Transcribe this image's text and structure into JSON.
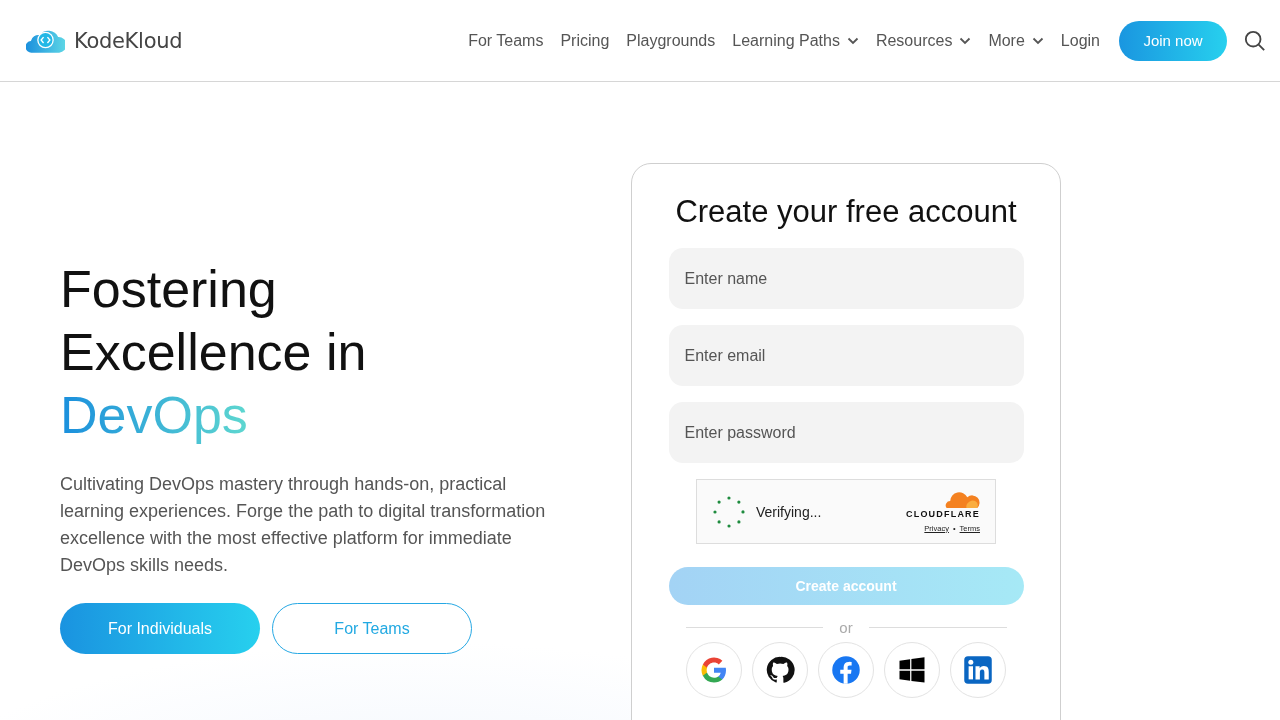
{
  "header": {
    "logo_text": "KodeKloud",
    "nav": [
      {
        "label": "For Teams",
        "kind": "link"
      },
      {
        "label": "Pricing",
        "kind": "link"
      },
      {
        "label": "Playgrounds",
        "kind": "link"
      },
      {
        "label": "Learning Paths",
        "kind": "dropdown"
      },
      {
        "label": "Resources",
        "kind": "dropdown"
      },
      {
        "label": "More",
        "kind": "dropdown"
      },
      {
        "label": "Login",
        "kind": "link"
      }
    ],
    "join_button": "Join now"
  },
  "hero": {
    "heading": "Fostering Excellence in",
    "heading_accent": "DevOps",
    "description": "Cultivating DevOps mastery through hands-on, practical learning experiences. Forge the path to digital transformation excellence with the most effective platform for immediate DevOps skills needs.",
    "buttons": [
      {
        "label": "For Individuals",
        "kind": "primary"
      },
      {
        "label": "For Teams",
        "kind": "outline"
      }
    ]
  },
  "signup": {
    "title": "Create your free account",
    "fields": [
      {
        "placeholder": "Enter name"
      },
      {
        "placeholder": "Enter email"
      },
      {
        "placeholder": "Enter password"
      }
    ],
    "captcha": {
      "status": "Verifying...",
      "brand": "CLOUDFLARE",
      "links": [
        "Privacy",
        "Terms"
      ],
      "separator": "•"
    },
    "submit": {
      "label": "Create account",
      "disabled": true
    },
    "divider": "or",
    "social": [
      {
        "kind": "google"
      },
      {
        "kind": "github"
      },
      {
        "kind": "facebook"
      },
      {
        "kind": "windows"
      },
      {
        "kind": "linkedin"
      }
    ]
  }
}
